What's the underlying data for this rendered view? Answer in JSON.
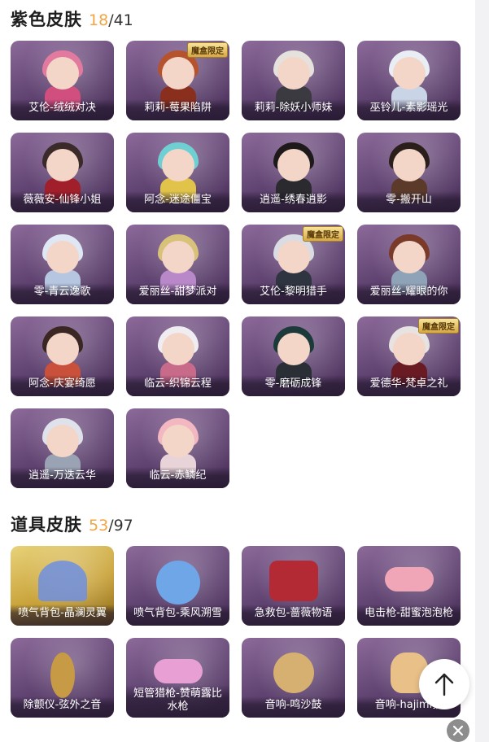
{
  "purple_section": {
    "title": "紫色皮肤",
    "owned": "18",
    "separator": "/",
    "total": "41",
    "items": [
      {
        "label": "艾伦-绒绒对决",
        "badge": "",
        "hair": "#e27aa0",
        "cloth": "#d14f7e"
      },
      {
        "label": "莉莉-莓果陷阱",
        "badge": "魔盒限定",
        "hair": "#b5532e",
        "cloth": "#8a2f1d"
      },
      {
        "label": "莉莉-除妖小师妹",
        "badge": "",
        "hair": "#e5e2de",
        "cloth": "#3a3a40"
      },
      {
        "label": "巫铃儿-素影瑶光",
        "badge": "",
        "hair": "#e9eef5",
        "cloth": "#c9d4e6"
      },
      {
        "label": "薇薇安-仙锋小姐",
        "badge": "",
        "hair": "#3a2a2a",
        "cloth": "#a11f2a"
      },
      {
        "label": "阿念-迷途僵宝",
        "badge": "",
        "hair": "#6fd0d4",
        "cloth": "#e2c34a"
      },
      {
        "label": "逍遥-绣春逍影",
        "badge": "",
        "hair": "#1e1a1c",
        "cloth": "#2b2a2e"
      },
      {
        "label": "零-搬开山",
        "badge": "",
        "hair": "#2b1f1b",
        "cloth": "#5b3a2a"
      },
      {
        "label": "零-青云逸歌",
        "badge": "",
        "hair": "#dfe7f4",
        "cloth": "#b6c6e0"
      },
      {
        "label": "爱丽丝-甜梦派对",
        "badge": "",
        "hair": "#d8c27a",
        "cloth": "#b888c8"
      },
      {
        "label": "艾伦-黎明猎手",
        "badge": "魔盒限定",
        "hair": "#d9dde3",
        "cloth": "#2e3440"
      },
      {
        "label": "爱丽丝-耀眼的你",
        "badge": "",
        "hair": "#7a3a2a",
        "cloth": "#8fa3b8"
      },
      {
        "label": "阿念-庆宴绮愿",
        "badge": "",
        "hair": "#3a2622",
        "cloth": "#c9503a"
      },
      {
        "label": "临云-织锦云程",
        "badge": "",
        "hair": "#f0edf2",
        "cloth": "#c86a8a"
      },
      {
        "label": "零-磨砺成锋",
        "badge": "",
        "hair": "#1c3a3a",
        "cloth": "#2a2f36"
      },
      {
        "label": "爱德华-梵卓之礼",
        "badge": "魔盒限定",
        "hair": "#e7e3e2",
        "cloth": "#6a1a22"
      },
      {
        "label": "逍遥-万迭云华",
        "badge": "",
        "hair": "#dfe2ea",
        "cloth": "#9aa3b4"
      },
      {
        "label": "临云-赤鳞纪",
        "badge": "",
        "hair": "#f2b7c0",
        "cloth": "#e8d4d8"
      }
    ]
  },
  "item_section": {
    "title": "道具皮肤",
    "owned": "53",
    "separator": "/",
    "total": "97",
    "items": [
      {
        "label": "喷气背包-晶澜灵翼",
        "kind": "wings",
        "gold": true,
        "color": "#6f8fe0"
      },
      {
        "label": "喷气背包-乘风溯雪",
        "kind": "pack",
        "gold": false,
        "color": "#6ea6e8"
      },
      {
        "label": "急救包-蔷薇物语",
        "kind": "kit",
        "gold": false,
        "color": "#b32a34"
      },
      {
        "label": "电击枪-甜蜜泡泡枪",
        "kind": "gun",
        "gold": false,
        "color": "#f0a6b6"
      },
      {
        "label": "除颤仪-弦外之音",
        "kind": "lute",
        "gold": false,
        "color": "#c79a46"
      },
      {
        "label": "短管猎枪-赞萌露比水枪",
        "kind": "gun",
        "gold": false,
        "color": "#e8a0d4"
      },
      {
        "label": "音响-鸣沙鼓",
        "kind": "drum",
        "gold": false,
        "color": "#d6b070"
      },
      {
        "label": "音响-hajimi猫",
        "kind": "cat",
        "gold": false,
        "color": "#e8c088"
      }
    ]
  },
  "controls": {
    "back_to_top_icon": "arrow-up-icon",
    "close_icon": "close-icon"
  }
}
